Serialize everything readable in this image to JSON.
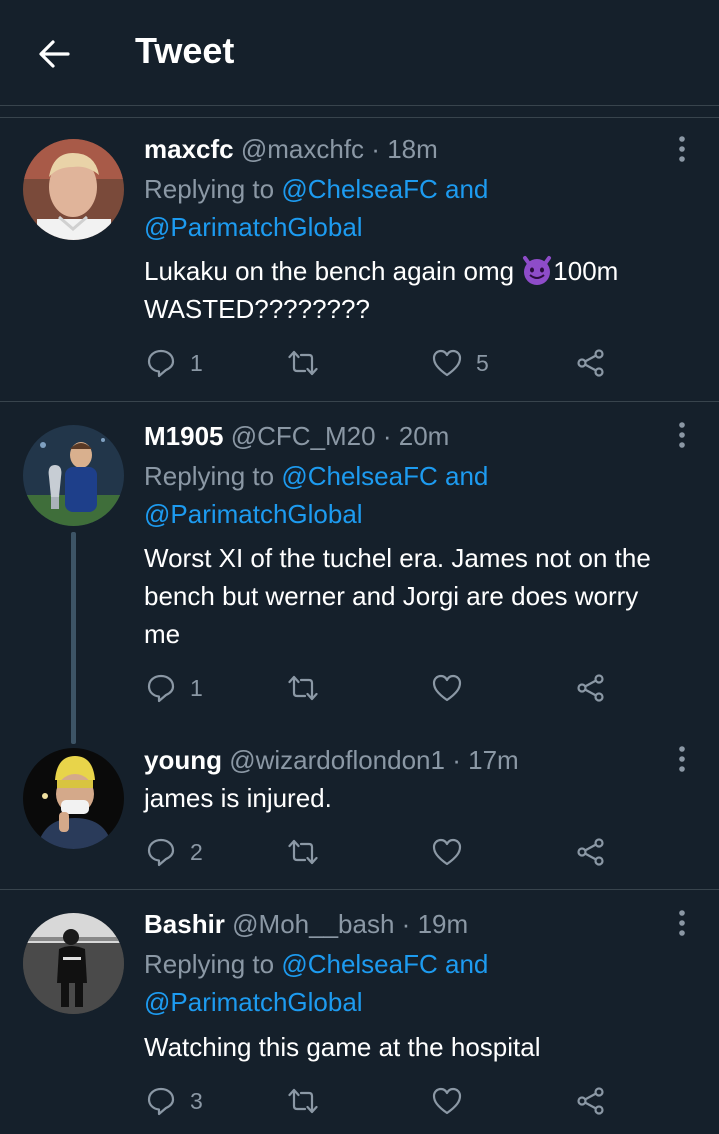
{
  "header": {
    "title": "Tweet"
  },
  "tweets": [
    {
      "name": "maxcfc",
      "handle": "@maxchfc",
      "dot": "·",
      "time": "18m",
      "reply_prefix": "Replying to",
      "reply_mention_1": "@ChelseaFC and",
      "reply_mention_2": "@ParimatchGlobal",
      "text_line_1": "Lukaku on the bench again omg",
      "emoji": "smiling-imp-emoji",
      "text_line_1b": "100m",
      "text_line_2": "WASTED????????",
      "replies": "1",
      "retweets": "",
      "likes": "5"
    },
    {
      "name": "M1905",
      "handle": "@CFC_M20",
      "dot": "·",
      "time": "20m",
      "reply_prefix": "Replying to",
      "reply_mention_1": "@ChelseaFC and",
      "reply_mention_2": "@ParimatchGlobal",
      "text_line_1": "Worst XI of the tuchel era. James not on the",
      "text_line_2": "bench but werner and Jorgi are does worry",
      "text_line_3": "me",
      "replies": "1",
      "retweets": "",
      "likes": ""
    },
    {
      "name": "young",
      "handle": "@wizardoflondon1",
      "dot": "·",
      "time": "17m",
      "text_line_1": "james is injured.",
      "replies": "2",
      "retweets": "",
      "likes": ""
    },
    {
      "name": "Bashir",
      "handle": "@Moh__bash",
      "dot": "·",
      "time": "19m",
      "reply_prefix": "Replying to",
      "reply_mention_1": "@ChelseaFC and",
      "reply_mention_2": "@ParimatchGlobal",
      "text_line_1": "Watching this game at the hospital",
      "replies": "3",
      "retweets": "",
      "likes": ""
    }
  ],
  "colors": {
    "background": "#15202b",
    "secondary_text": "#8b98a5",
    "link": "#1d9bf0",
    "divider": "#38444d"
  }
}
